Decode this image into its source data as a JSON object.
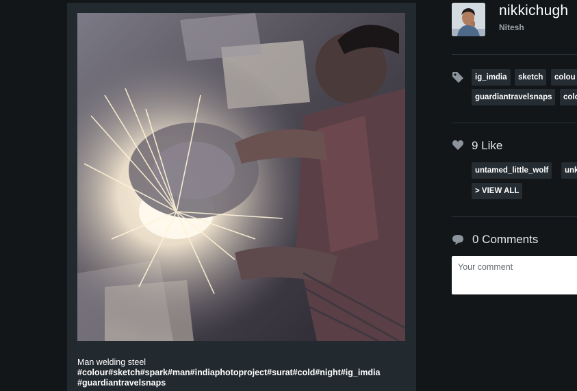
{
  "post": {
    "caption_title": "Man welding steel",
    "caption_tags_line1": "#colour#sketch#spark#man#indiaphotoproject#surat#cold#night#ig_imdia",
    "caption_tags_line2": "#guardiantravelsnaps"
  },
  "user": {
    "username": "nikkichugh",
    "display_name": "Nitesh"
  },
  "tags": {
    "icon": "tag-icon",
    "items": [
      "ig_imdia",
      "sketch",
      "colou",
      "guardiantravelsnaps",
      "colo"
    ]
  },
  "likes": {
    "icon": "heart-icon",
    "label": "9 Like",
    "likers": [
      "untamed_little_wolf",
      "unk"
    ],
    "view_all_label": "> VIEW ALL"
  },
  "comments": {
    "icon": "speech-bubble-icon",
    "label": "0 Comments",
    "input_placeholder": "Your comment",
    "input_value": ""
  },
  "colors": {
    "background": "#121619",
    "card": "#22292f",
    "tag_bg": "#252c32",
    "muted_text": "#9aa3ab"
  }
}
